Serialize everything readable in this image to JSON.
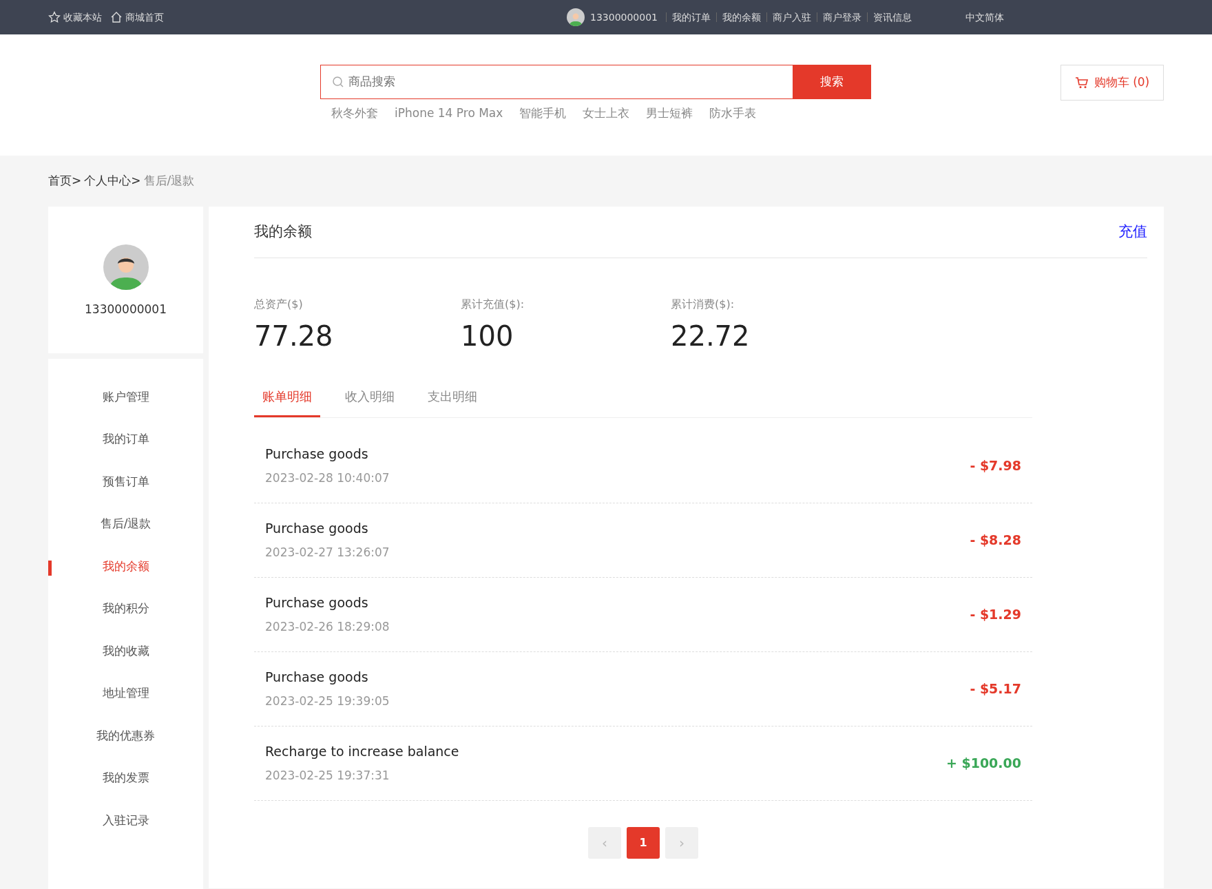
{
  "topbar": {
    "left": [
      {
        "kind": "star",
        "label": "收藏本站"
      },
      {
        "kind": "home",
        "label": "商城首页"
      }
    ],
    "user": "13300000001",
    "links": [
      "我的订单",
      "我的余额",
      "商户入驻",
      "商户登录",
      "资讯信息"
    ],
    "language": "中文简体"
  },
  "search": {
    "placeholder": "商品搜索",
    "button": "搜索",
    "hot": [
      "秋冬外套",
      "iPhone 14 Pro Max",
      "智能手机",
      "女士上衣",
      "男士短裤",
      "防水手表"
    ]
  },
  "cart": {
    "label": "购物车 (0)"
  },
  "breadcrumb": [
    "首页>",
    "个人中心>",
    "售后/退款"
  ],
  "profile": {
    "user": "13300000001"
  },
  "sidebar": {
    "items": [
      {
        "label": "账户管理",
        "selected": false
      },
      {
        "label": "我的订单",
        "selected": false
      },
      {
        "label": "预售订单",
        "selected": false
      },
      {
        "label": "售后/退款",
        "selected": false
      },
      {
        "label": "我的余额",
        "selected": true
      },
      {
        "label": "我的积分",
        "selected": false
      },
      {
        "label": "我的收藏",
        "selected": false
      },
      {
        "label": "地址管理",
        "selected": false
      },
      {
        "label": "我的优惠券",
        "selected": false
      },
      {
        "label": "我的发票",
        "selected": false
      },
      {
        "label": "入驻记录",
        "selected": false
      }
    ]
  },
  "panel": {
    "title": "我的余额",
    "action": "充值"
  },
  "stats": [
    {
      "label": "总资产($)",
      "value": "77.28"
    },
    {
      "label": "累计充值($):",
      "value": "100"
    },
    {
      "label": "累计消费($):",
      "value": "22.72"
    }
  ],
  "tabs": [
    {
      "label": "账单明细",
      "selected": true
    },
    {
      "label": "收入明细",
      "selected": false
    },
    {
      "label": "支出明细",
      "selected": false
    }
  ],
  "transactions": [
    {
      "title": "Purchase goods",
      "time": "2023-02-28 10:40:07",
      "amount": "- $7.98",
      "kind": "expense"
    },
    {
      "title": "Purchase goods",
      "time": "2023-02-27 13:26:07",
      "amount": "- $8.28",
      "kind": "expense"
    },
    {
      "title": "Purchase goods",
      "time": "2023-02-26 18:29:08",
      "amount": "- $1.29",
      "kind": "expense"
    },
    {
      "title": "Purchase goods",
      "time": "2023-02-25 19:39:05",
      "amount": "- $5.17",
      "kind": "expense"
    },
    {
      "title": "Recharge to increase balance",
      "time": "2023-02-25 19:37:31",
      "amount": "+ $100.00",
      "kind": "income"
    }
  ],
  "pagination": {
    "prev": "‹",
    "pages": [
      {
        "label": "1",
        "selected": true
      }
    ],
    "next": "›"
  }
}
